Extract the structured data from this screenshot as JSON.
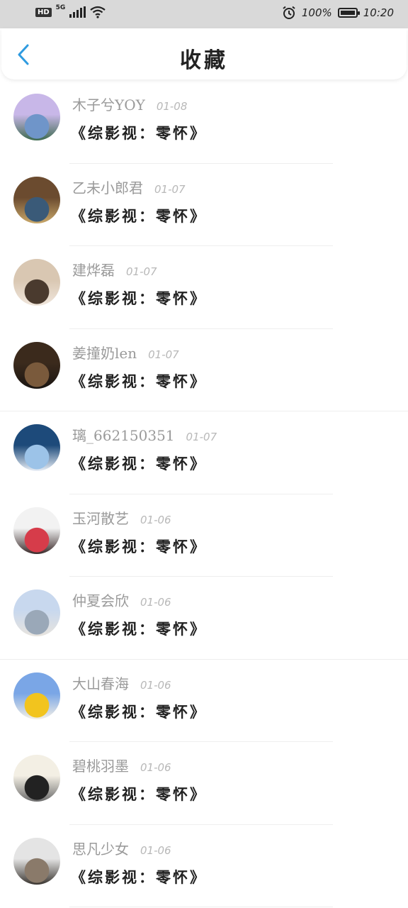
{
  "status_bar": {
    "hd": "HD",
    "network": "5G",
    "battery": "100%",
    "time": "10:20",
    "icons": [
      "signal-icon",
      "wifi-icon",
      "alarm-icon",
      "battery-icon"
    ]
  },
  "header": {
    "back_icon": "chevron-left-icon",
    "title": "收藏",
    "accent": "#2f9be0"
  },
  "favorites": [
    {
      "name": "木子兮YOY",
      "date": "01-08",
      "title": "《综影视：零怀》",
      "avatar_colors": [
        "#c8b7e8",
        "#6f95c9",
        "#3d6a4f"
      ]
    },
    {
      "name": "乙未小郎君",
      "date": "01-07",
      "title": "《综影视：零怀》",
      "avatar_colors": [
        "#6b4b2f",
        "#3a5a78",
        "#c9a86a"
      ]
    },
    {
      "name": "建烨磊",
      "date": "01-07",
      "title": "《综影视：零怀》",
      "avatar_colors": [
        "#d9c7b2",
        "#4a3a2e",
        "#f0e6dc"
      ]
    },
    {
      "name": "姜撞奶len",
      "date": "01-07",
      "title": "《综影视：零怀》",
      "avatar_colors": [
        "#3b2a1c",
        "#7a5a3c",
        "#1a1512"
      ]
    },
    {
      "name": "璃_662150351",
      "date": "01-07",
      "title": "《综影视：零怀》",
      "avatar_colors": [
        "#1d4a7a",
        "#9cc3e8",
        "#e8eef6"
      ]
    },
    {
      "name": "玉河散艺",
      "date": "01-06",
      "title": "《综影视：零怀》",
      "avatar_colors": [
        "#f2f2f2",
        "#d63c4a",
        "#3a2a2a"
      ]
    },
    {
      "name": "仲夏会欣",
      "date": "01-06",
      "title": "《综影视：零怀》",
      "avatar_colors": [
        "#c8d8ee",
        "#9aa8b8",
        "#e8e4de"
      ]
    },
    {
      "name": "大山春海",
      "date": "01-06",
      "title": "《综影视：零怀》",
      "avatar_colors": [
        "#7aa6e6",
        "#f2c41e",
        "#f4f0e6"
      ]
    },
    {
      "name": "碧桃羽墨",
      "date": "01-06",
      "title": "《综影视：零怀》",
      "avatar_colors": [
        "#f3efe4",
        "#222222",
        "#6b6b6b"
      ]
    },
    {
      "name": "思凡少女",
      "date": "01-06",
      "title": "《综影视：零怀》",
      "avatar_colors": [
        "#e4e4e4",
        "#8a7a6a",
        "#3a3530"
      ]
    }
  ]
}
